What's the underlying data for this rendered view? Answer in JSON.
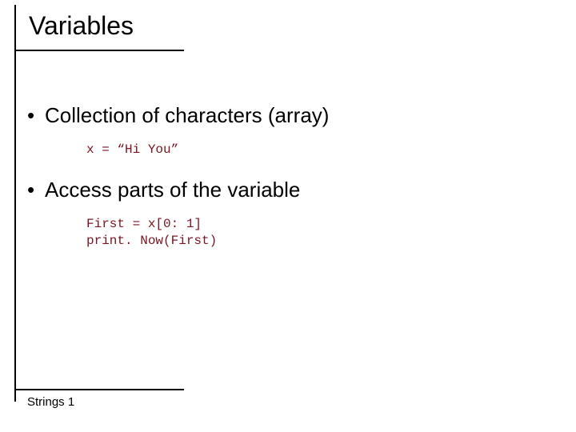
{
  "slide": {
    "title": "Variables",
    "bullets": [
      {
        "text": "Collection of characters (array)",
        "code": "x = “Hi You”"
      },
      {
        "text": "Access parts of the variable",
        "code": "First = x[0: 1]\nprint. Now(First)"
      }
    ],
    "footer": "Strings 1"
  }
}
